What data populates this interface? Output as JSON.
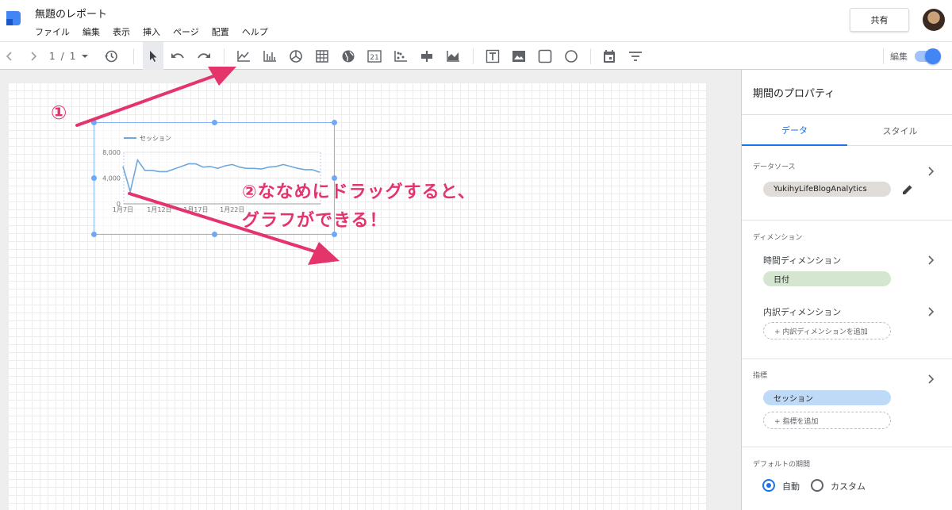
{
  "header": {
    "title": "無題のレポート",
    "menu": [
      "ファイル",
      "編集",
      "表示",
      "挿入",
      "ページ",
      "配置",
      "ヘルプ"
    ],
    "share_label": "共有"
  },
  "toolbar": {
    "page_current": "1",
    "page_sep": "/",
    "page_total": "1",
    "edit_label": "編集",
    "edit_mode_on": true
  },
  "chart_data": {
    "type": "line",
    "legend": "セッション",
    "series": [
      {
        "name": "セッション",
        "values": [
          5800,
          1900,
          6800,
          5200,
          5200,
          5000,
          5000,
          5400,
          5800,
          6200,
          6200,
          5700,
          5800,
          5500,
          5900,
          6100,
          5700,
          5500,
          5500,
          5400,
          5700,
          5800,
          6100,
          5800,
          5500,
          5300,
          5300,
          4900
        ]
      }
    ],
    "yticks": [
      "8,000",
      "4,000",
      "0"
    ],
    "xticks": [
      "1月7日",
      "1月12日",
      "1月17日",
      "1月22日"
    ],
    "ylim": [
      0,
      8000
    ]
  },
  "annotations": {
    "step1": "①",
    "step2_line1": "②ななめにドラッグすると、",
    "step2_line2": "グラフができる！"
  },
  "panel": {
    "title": "期間のプロパティ",
    "tabs": [
      "データ",
      "スタイル"
    ],
    "data_source_label": "データソース",
    "data_source_value": "YukihyLifeBlogAnalytics",
    "dimension_label": "ディメンション",
    "time_dimension_label": "時間ディメンション",
    "time_dimension_value": "日付",
    "breakdown_label": "内訳ディメンション",
    "add_breakdown": "+ 内訳ディメンションを追加",
    "metric_label": "指標",
    "metric_value": "セッション",
    "add_metric": "+ 指標を追加",
    "default_period_label": "デフォルトの期間",
    "period_options": [
      "自動",
      "カスタム"
    ]
  },
  "colors": {
    "accent": "#1a73e8",
    "annotation": "#e5336c",
    "chart_line": "#6fa8dc"
  }
}
